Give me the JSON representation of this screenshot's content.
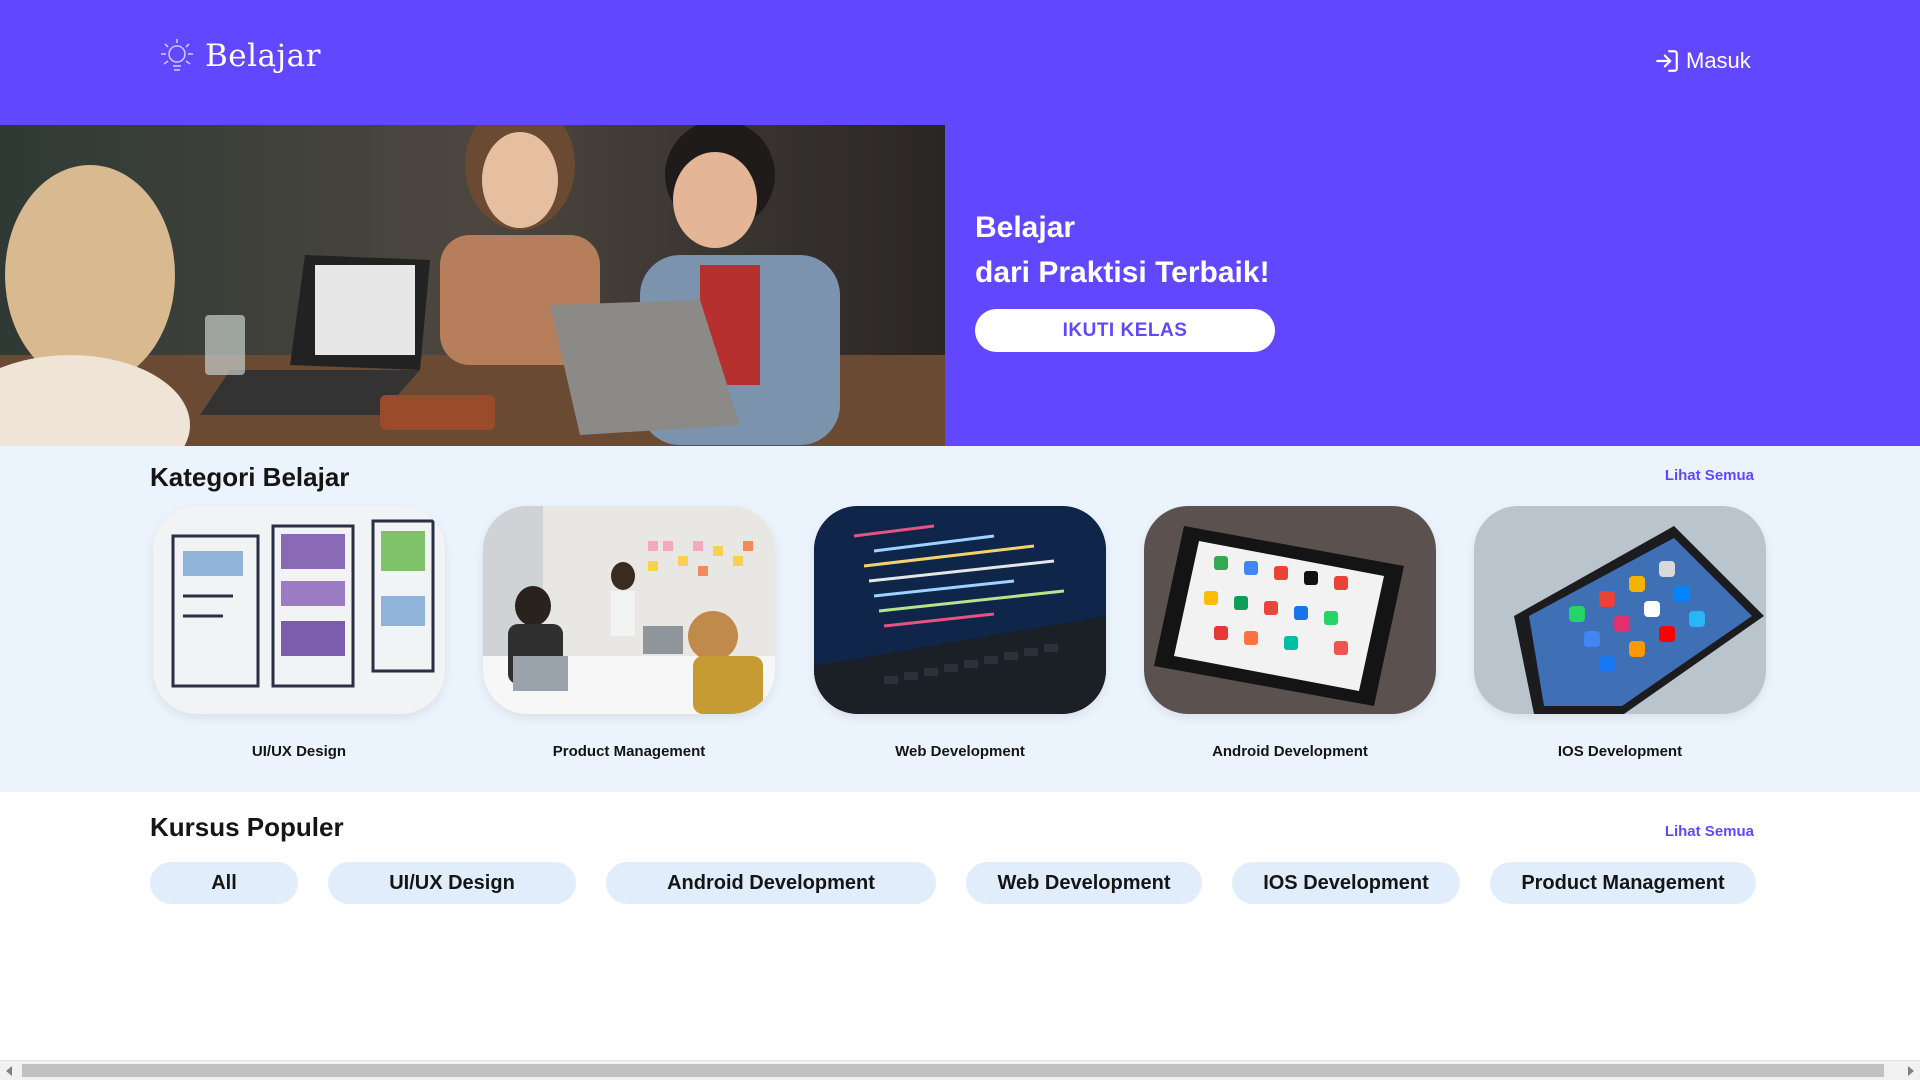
{
  "brand": {
    "name": "Belajar",
    "logo_icon": "lightbulb-logo-icon"
  },
  "header": {
    "login_label": "Masuk",
    "login_icon": "sign-in-icon"
  },
  "hero": {
    "headline_line1": "Belajar",
    "headline_line2": "dari Praktisi Terbaik!",
    "cta_label": "IKUTI KELAS",
    "image": "students-with-laptops-photo"
  },
  "categories": {
    "title": "Kategori Belajar",
    "see_all": "Lihat Semua",
    "items": [
      {
        "label": "UI/UX Design",
        "image": "wireframe-sketch-photo"
      },
      {
        "label": "Product Management",
        "image": "team-meeting-photo"
      },
      {
        "label": "Web Development",
        "image": "code-on-laptop-photo"
      },
      {
        "label": "Android Development",
        "image": "android-phone-photo"
      },
      {
        "label": "IOS Development",
        "image": "iphone-homescreen-photo"
      }
    ]
  },
  "popular": {
    "title": "Kursus Populer",
    "see_all": "Lihat Semua",
    "filters": [
      "All",
      "UI/UX Design",
      "Android Development",
      "Web Development",
      "IOS Development",
      "Product Management"
    ]
  },
  "colors": {
    "primary": "#6148ff",
    "category_bg": "#ebf3fc",
    "chip_bg": "#e2edfc"
  }
}
